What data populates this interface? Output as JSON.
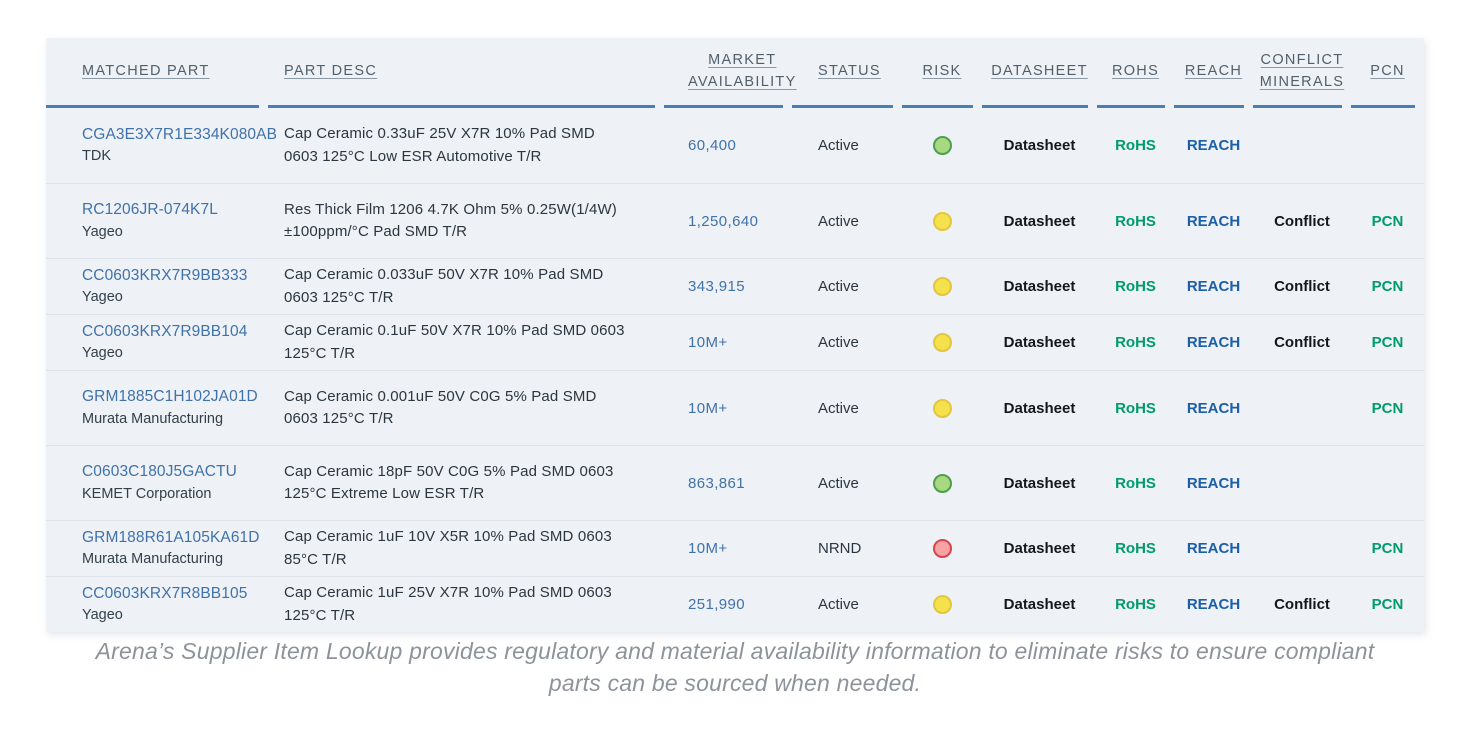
{
  "table": {
    "columns": [
      {
        "key": "matched_part",
        "label": "MATCHED PART"
      },
      {
        "key": "part_desc",
        "label": "PART DESC"
      },
      {
        "key": "market_availability",
        "label_line1": "MARKET",
        "label_line2": "AVAILABILITY"
      },
      {
        "key": "status",
        "label": "STATUS"
      },
      {
        "key": "risk",
        "label": "RISK"
      },
      {
        "key": "datasheet",
        "label": "DATASHEET"
      },
      {
        "key": "rohs",
        "label": "ROHS"
      },
      {
        "key": "reach",
        "label": "REACH"
      },
      {
        "key": "conflict_minerals",
        "label_line1": "CONFLICT",
        "label_line2": "MINERALS"
      },
      {
        "key": "pcn",
        "label": "PCN"
      }
    ],
    "rows": [
      {
        "mpn": "CGA3E3X7R1E334K080AB",
        "manufacturer": "TDK",
        "desc_line1": "Cap Ceramic 0.33uF 25V X7R 10% Pad SMD",
        "desc_line2": "0603 125°C Low ESR Automotive T/R",
        "availability": "60,400",
        "status": "Active",
        "risk": "green",
        "datasheet": "Datasheet",
        "rohs": "RoHS",
        "reach": "REACH",
        "conflict": "",
        "pcn": ""
      },
      {
        "mpn": "RC1206JR-074K7L",
        "manufacturer": "Yageo",
        "desc_line1": "Res Thick Film 1206 4.7K Ohm 5% 0.25W(1/4W)",
        "desc_line2": "±100ppm/°C Pad SMD T/R",
        "availability": "1,250,640",
        "status": "Active",
        "risk": "yellow",
        "datasheet": "Datasheet",
        "rohs": "RoHS",
        "reach": "REACH",
        "conflict": "Conflict",
        "pcn": "PCN"
      },
      {
        "mpn": "CC0603KRX7R9BB333",
        "manufacturer": "Yageo",
        "desc_line1": "Cap Ceramic 0.033uF 50V X7R 10% Pad SMD",
        "desc_line2": "0603 125°C T/R",
        "availability": "343,915",
        "status": "Active",
        "risk": "yellow",
        "datasheet": "Datasheet",
        "rohs": "RoHS",
        "reach": "REACH",
        "conflict": "Conflict",
        "pcn": "PCN"
      },
      {
        "mpn": "CC0603KRX7R9BB104",
        "manufacturer": "Yageo",
        "desc_line1": "Cap Ceramic 0.1uF 50V X7R 10% Pad SMD 0603",
        "desc_line2": "125°C T/R",
        "availability": "10M+",
        "status": "Active",
        "risk": "yellow",
        "datasheet": "Datasheet",
        "rohs": "RoHS",
        "reach": "REACH",
        "conflict": "Conflict",
        "pcn": "PCN"
      },
      {
        "mpn": "GRM1885C1H102JA01D",
        "manufacturer": "Murata Manufacturing",
        "desc_line1": "Cap Ceramic 0.001uF 50V C0G 5% Pad SMD",
        "desc_line2": "0603 125°C T/R",
        "availability": "10M+",
        "status": "Active",
        "risk": "yellow",
        "datasheet": "Datasheet",
        "rohs": "RoHS",
        "reach": "REACH",
        "conflict": "",
        "pcn": "PCN"
      },
      {
        "mpn": "C0603C180J5GACTU",
        "manufacturer": "KEMET Corporation",
        "desc_line1": "Cap Ceramic 18pF 50V C0G 5% Pad SMD 0603",
        "desc_line2": "125°C Extreme Low ESR T/R",
        "availability": "863,861",
        "status": "Active",
        "risk": "green",
        "datasheet": "Datasheet",
        "rohs": "RoHS",
        "reach": "REACH",
        "conflict": "",
        "pcn": ""
      },
      {
        "mpn": "GRM188R61A105KA61D",
        "manufacturer": "Murata Manufacturing",
        "desc_line1": "Cap Ceramic 1uF 10V X5R 10% Pad SMD 0603",
        "desc_line2": "85°C T/R",
        "availability": "10M+",
        "status": "NRND",
        "risk": "red",
        "datasheet": "Datasheet",
        "rohs": "RoHS",
        "reach": "REACH",
        "conflict": "",
        "pcn": "PCN"
      },
      {
        "mpn": "CC0603KRX7R8BB105",
        "manufacturer": "Yageo",
        "desc_line1": "Cap Ceramic 1uF 25V X7R 10% Pad SMD 0603",
        "desc_line2": "125°C T/R",
        "availability": "251,990",
        "status": "Active",
        "risk": "yellow",
        "datasheet": "Datasheet",
        "rohs": "RoHS",
        "reach": "REACH",
        "conflict": "Conflict",
        "pcn": "PCN"
      }
    ]
  },
  "caption": {
    "line1": "Arena’s Supplier Item Lookup provides regulatory and material availability information to eliminate risks to ensure",
    "line2": "compliant parts can be sourced when needed."
  },
  "colors": {
    "header_rule": "#4a7fb5",
    "link": "#3f72ab",
    "rohs": "#009b6e",
    "pcn": "#009b6e",
    "reach": "#1c5ea8",
    "datasheet": "#14181c",
    "risk_green": "#a8d87f",
    "risk_yellow": "#f4e14b",
    "risk_red": "#f7a3a3",
    "card_bg": "#eef1f5"
  }
}
